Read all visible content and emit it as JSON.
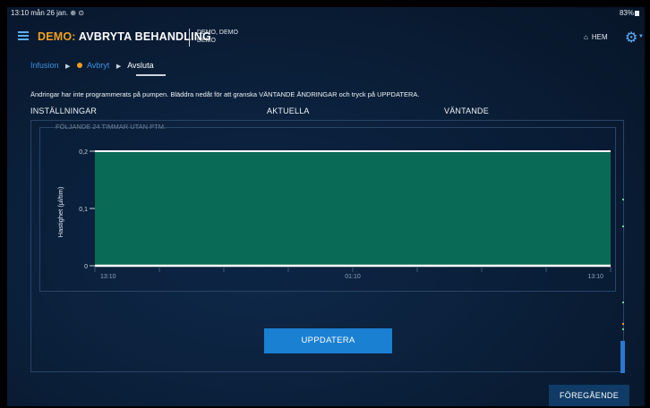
{
  "status_bar": {
    "time_date": "13:10  mån 26 jan.  ⊕ ⊙",
    "battery": "83%"
  },
  "header": {
    "title_prefix": "DEMO:",
    "title_main": "AVBRYTA BEHANDLING",
    "patient_line1": "DEMO, DEMO",
    "patient_line2": "DEMO",
    "home_label": "HEM"
  },
  "breadcrumb": {
    "step1": "Infusion",
    "step2": "Avbryt",
    "step3": "Avsluta"
  },
  "message": "Ändringar har inte programmerats på pumpen. Bläddra nedåt för att granska VÄNTANDE ÄNDRINGAR och tryck på UPPDATERA.",
  "columns": {
    "settings": "INSTÄLLNINGAR",
    "current": "AKTUELLA",
    "pending": "VÄNTANDE"
  },
  "chart_note": "FÖLJANDE 24 TIMMAR UTAN PTM.",
  "chart_data": {
    "type": "area",
    "ylabel": "Hastighet (µl/tim)",
    "xlabel": "",
    "ylim": [
      0,
      0.2
    ],
    "y_ticks": [
      "0,2",
      "0,1",
      "0"
    ],
    "x_ticks": [
      "13:10",
      "01:10",
      "13:10"
    ],
    "x": [
      "13:10",
      "13:10"
    ],
    "series": [
      {
        "values": [
          0.2,
          0.2
        ]
      }
    ],
    "fill_color": "#096b55",
    "line_color": "#ffffff",
    "grid": false
  },
  "buttons": {
    "update": "UPPDATERA",
    "previous": "FÖREGÅENDE"
  },
  "colors": {
    "accent": "#1a80d2",
    "demo_orange": "#f0a020",
    "link": "#3d8fe0"
  }
}
